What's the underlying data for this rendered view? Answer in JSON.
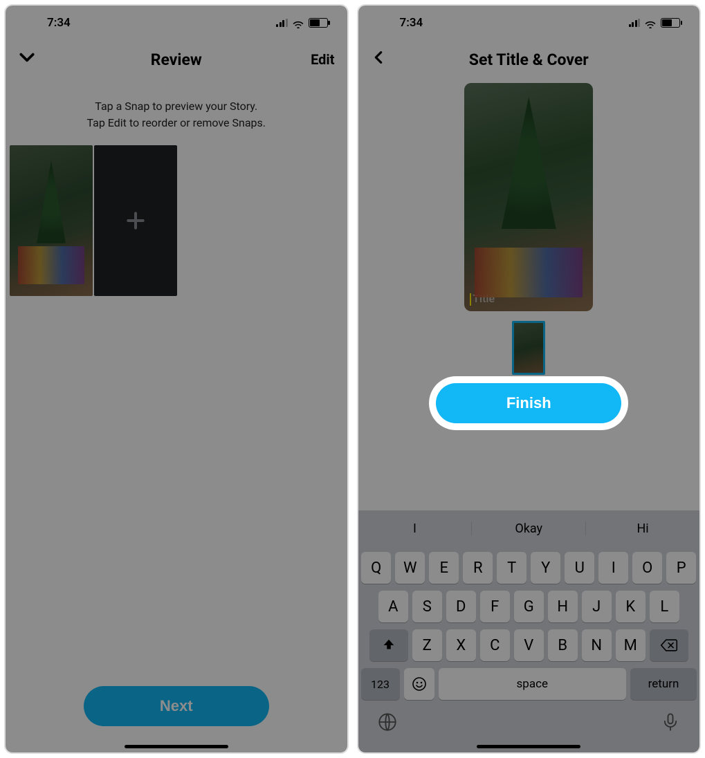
{
  "status": {
    "time": "7:34"
  },
  "left": {
    "title": "Review",
    "edit_label": "Edit",
    "sub_line1": "Tap a Snap to preview your Story.",
    "sub_line2": "Tap Edit to reorder or remove Snaps.",
    "next_label": "Next"
  },
  "right": {
    "title": "Set Title & Cover",
    "title_placeholder": "Title",
    "finish_label": "Finish"
  },
  "kbd": {
    "suggestions": [
      "I",
      "Okay",
      "Hi"
    ],
    "row1": [
      "Q",
      "W",
      "E",
      "R",
      "T",
      "Y",
      "U",
      "I",
      "O",
      "P"
    ],
    "row2": [
      "A",
      "S",
      "D",
      "F",
      "G",
      "H",
      "J",
      "K",
      "L"
    ],
    "row3": [
      "Z",
      "X",
      "C",
      "V",
      "B",
      "N",
      "M"
    ],
    "numbers_label": "123",
    "space_label": "space",
    "return_label": "return"
  }
}
